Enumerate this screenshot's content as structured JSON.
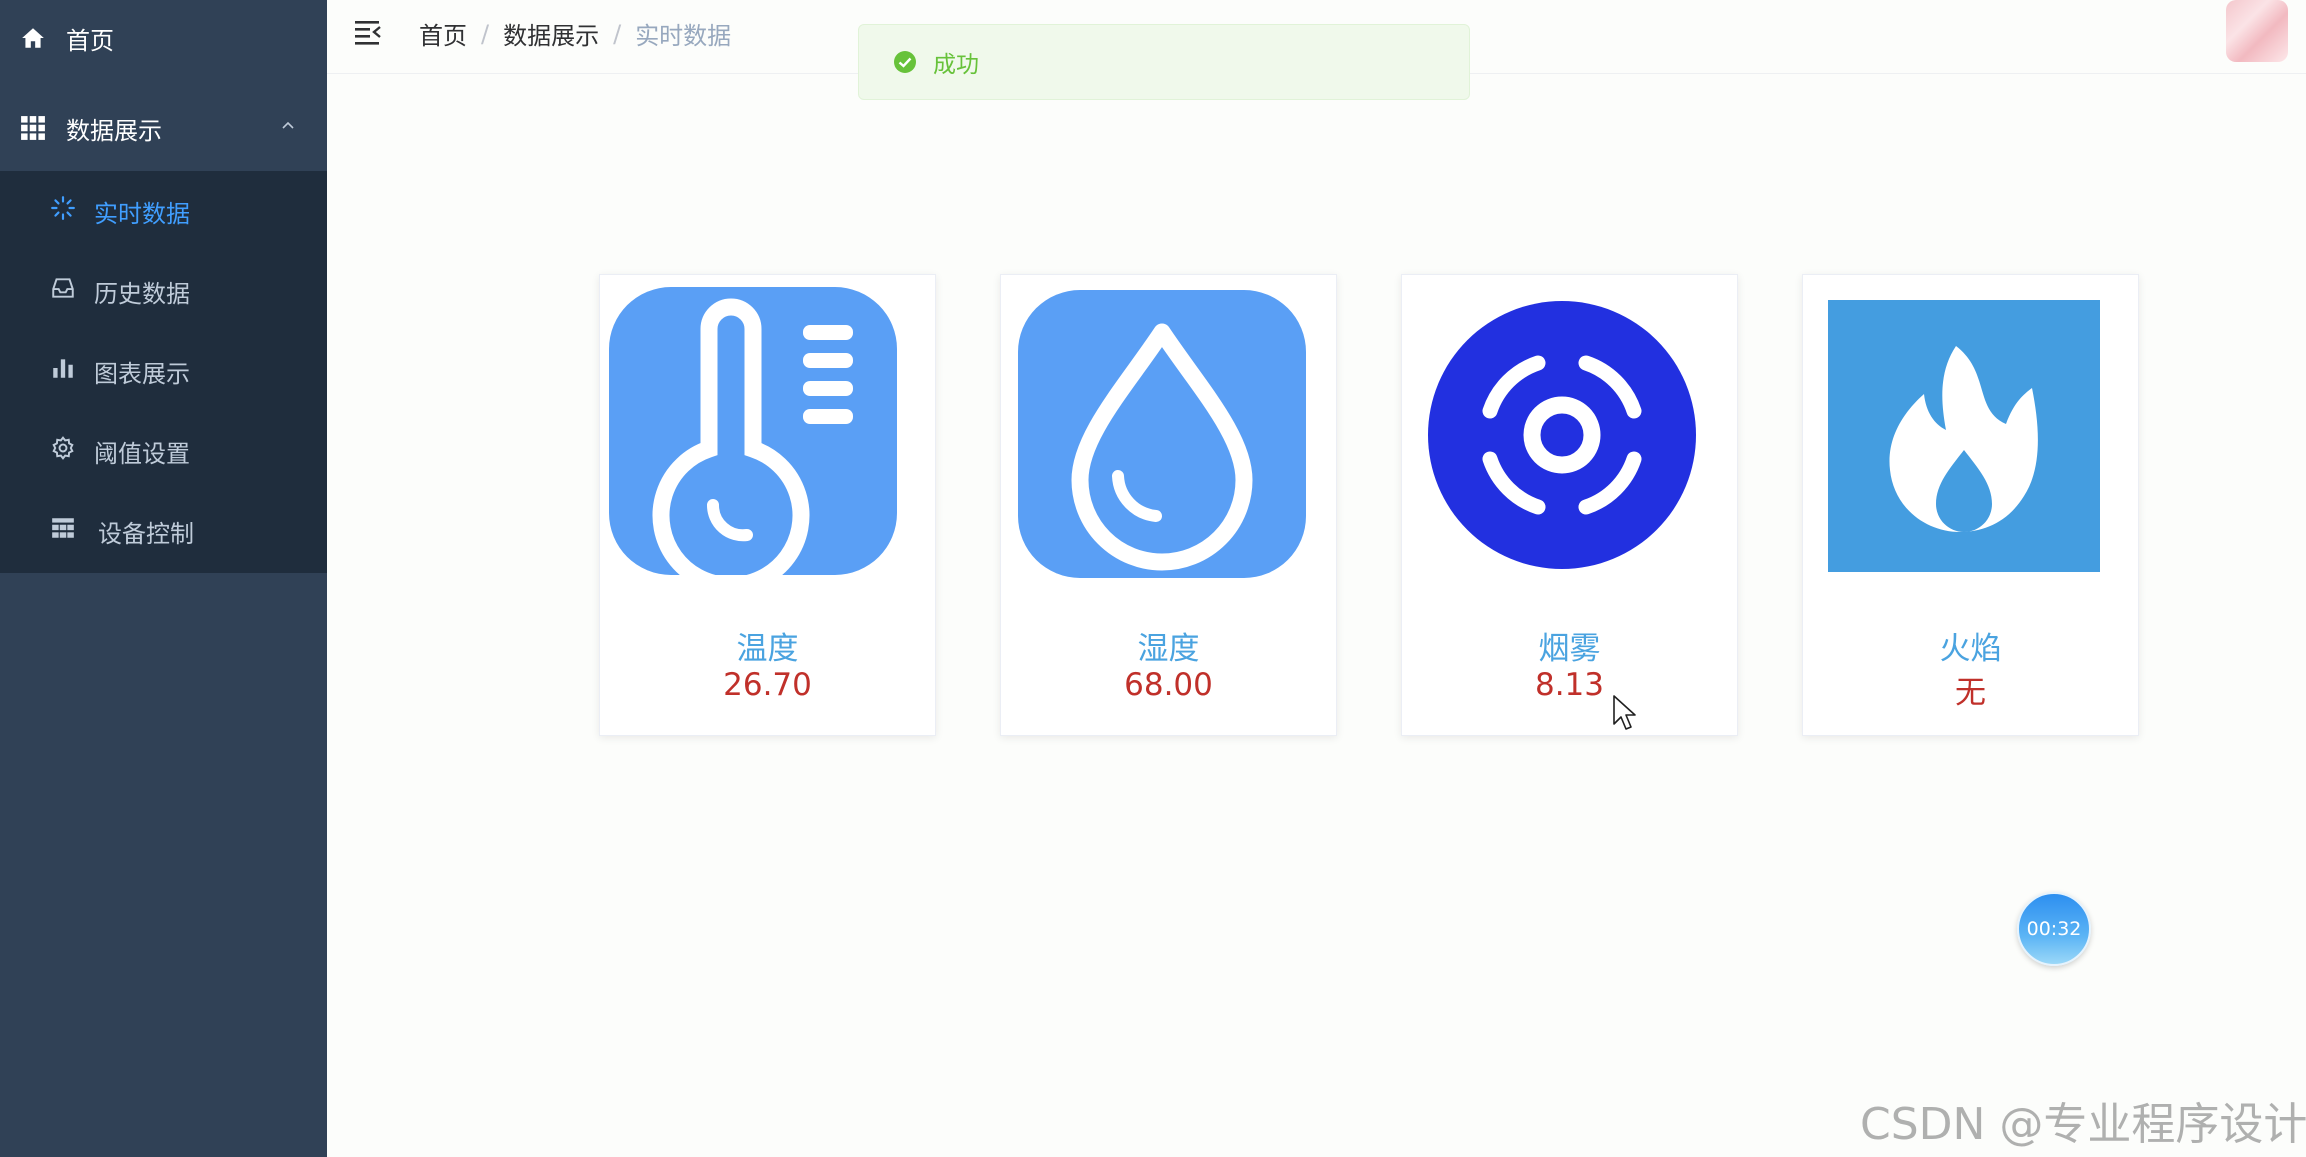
{
  "sidebar": {
    "home": {
      "label": "首页",
      "icon": "home-icon"
    },
    "group": {
      "label": "数据展示",
      "icon": "grid-icon"
    },
    "items": [
      {
        "label": "实时数据",
        "icon": "loading-icon",
        "active": true
      },
      {
        "label": "历史数据",
        "icon": "inbox-icon"
      },
      {
        "label": "图表展示",
        "icon": "bar-chart-icon"
      },
      {
        "label": "阈值设置",
        "icon": "gear-icon"
      },
      {
        "label": "设备控制",
        "icon": "table-icon"
      }
    ]
  },
  "breadcrumb": {
    "items": [
      "首页",
      "数据展示",
      "实时数据"
    ],
    "separator": "/"
  },
  "toast": {
    "message": "成功",
    "icon": "check-circle-icon",
    "color": "#67c23a"
  },
  "cards": [
    {
      "name": "温度",
      "value": "26.70",
      "icon": "thermometer-icon",
      "icon_bg": "#5a9ff5"
    },
    {
      "name": "湿度",
      "value": "68.00",
      "icon": "water-drop-icon",
      "icon_bg": "#5a9ff5"
    },
    {
      "name": "烟雾",
      "value": "8.13",
      "icon": "smoke-detector-icon",
      "icon_bg": "#2230e0"
    },
    {
      "name": "火焰",
      "value": "无",
      "icon": "flame-icon",
      "icon_bg": "#449de0"
    }
  ],
  "timer": {
    "text": "00:32"
  },
  "watermark": "CSDN @专业程序设计",
  "colors": {
    "sidebar_bg": "#304156",
    "submenu_bg": "#1f2d3d",
    "active": "#409eff",
    "card_title": "#4aa3e0",
    "card_value": "#c0302a"
  }
}
